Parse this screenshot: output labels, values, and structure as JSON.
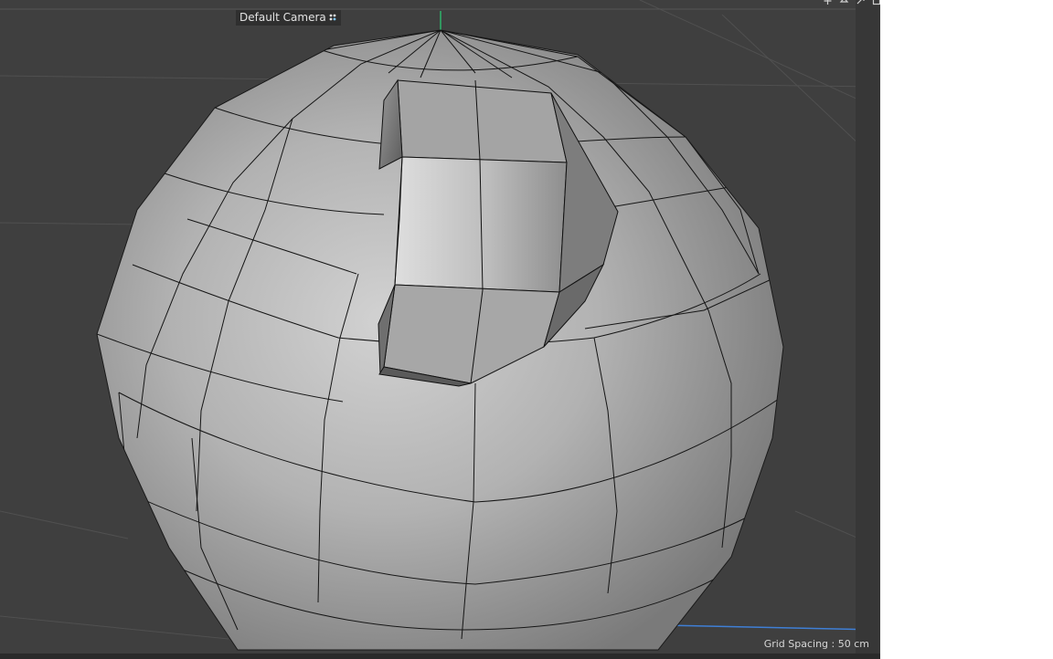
{
  "viewport": {
    "camera_label": "Default Camera",
    "camera_icon": "camera-indicator-icon",
    "grid_spacing": "Grid Spacing : 50 cm",
    "nav_icons": [
      "move-view-icon",
      "orbit-view-icon",
      "zoom-view-icon",
      "toggle-view-icon"
    ]
  },
  "colors": {
    "viewport_bg": "#3f3f3f",
    "axis_y": "#2fb36a",
    "axis_x": "#3f7fd6"
  }
}
